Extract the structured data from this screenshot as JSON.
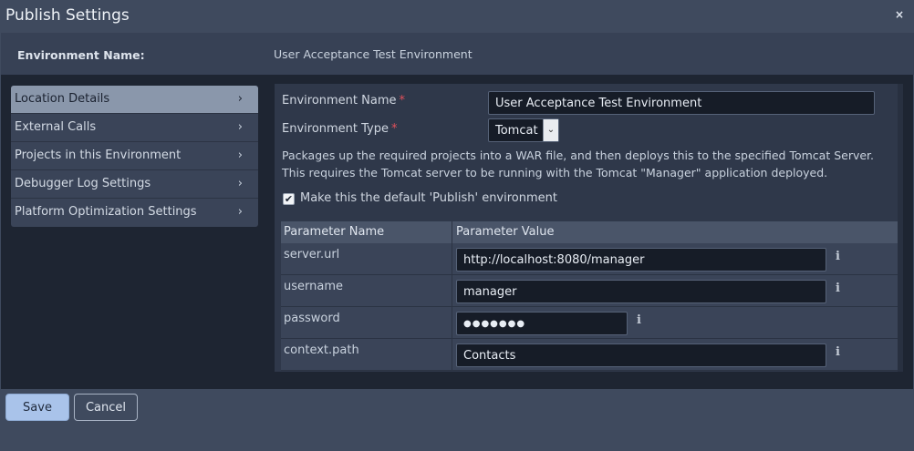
{
  "dialog": {
    "title": "Publish Settings",
    "close_symbol": "×"
  },
  "environment": {
    "label": "Environment Name:",
    "value": "User Acceptance Test Environment"
  },
  "sidebar": {
    "items": [
      {
        "label": "Location Details",
        "active": true
      },
      {
        "label": "External Calls",
        "active": false
      },
      {
        "label": "Projects in this Environment",
        "active": false
      },
      {
        "label": "Debugger Log Settings",
        "active": false
      },
      {
        "label": "Platform Optimization Settings",
        "active": false
      }
    ],
    "chevron": "›"
  },
  "form": {
    "env_name_label": "Environment Name",
    "env_name_value": "User Acceptance Test Environment",
    "env_type_label": "Environment Type",
    "env_type_value": "Tomcat",
    "required_marker": "*",
    "select_arrow": "⌄",
    "description": "Packages up the required projects into a WAR file, and then deploys this to the specified Tomcat Server. This requires the Tomcat server to be running with the Tomcat \"Manager\" application deployed.",
    "default_checkbox_label": "Make this the default 'Publish' environment",
    "default_checked": true,
    "check_symbol": "✔"
  },
  "params": {
    "col_name": "Parameter Name",
    "col_value": "Parameter Value",
    "info_symbol": "i",
    "rows": [
      {
        "name": "server.url",
        "value": "http://localhost:8080/manager",
        "masked": false
      },
      {
        "name": "username",
        "value": "manager",
        "masked": false
      },
      {
        "name": "password",
        "value": "●●●●●●●",
        "masked": true
      },
      {
        "name": "context.path",
        "value": "Contacts",
        "masked": false
      }
    ]
  },
  "footer": {
    "save_label": "Save",
    "cancel_label": "Cancel"
  },
  "colors": {
    "accent_save": "#a9c3ea",
    "sidebar_active": "#8a97ab",
    "required": "#e0505a"
  }
}
